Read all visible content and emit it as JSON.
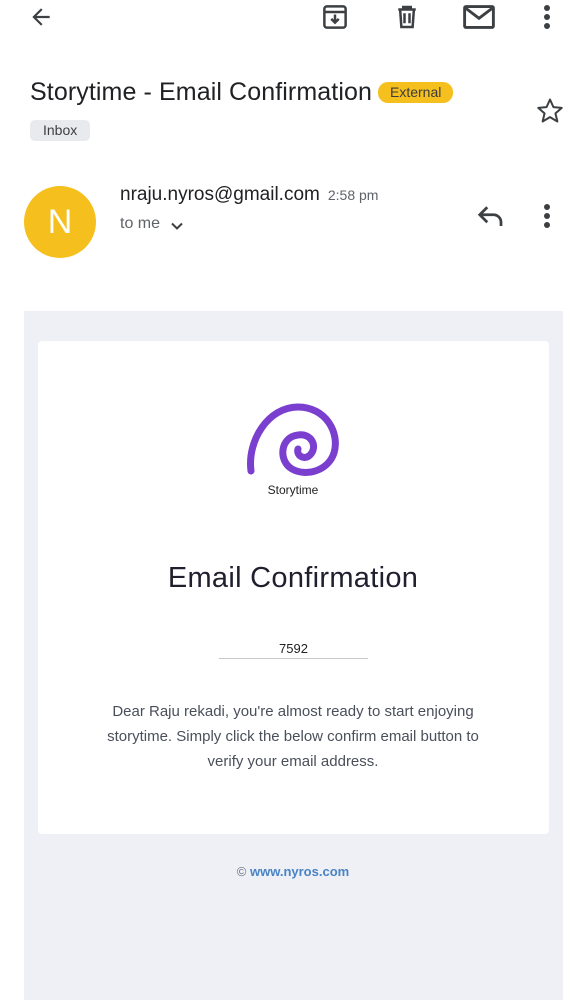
{
  "toolbar": {
    "back_icon": "arrow-left-icon",
    "archive_icon": "archive-icon",
    "delete_icon": "trash-icon",
    "mark_unread_icon": "mail-icon",
    "more_icon": "more-vert-icon"
  },
  "message": {
    "subject": "Storytime - Email Confirmation",
    "external_badge": "External",
    "label": "Inbox",
    "star_icon": "star-outline-icon",
    "sender_initial": "N",
    "sender_email": "nraju.nyros@gmail.com",
    "time": "2:58 pm",
    "recipient": "to me",
    "reply_icon": "reply-icon",
    "more_icon": "more-vert-icon"
  },
  "email_body": {
    "brand_name": "Storytime",
    "headline": "Email Confirmation",
    "code": "7592",
    "paragraph": "Dear Raju rekadi, you're almost ready to start enjoying storytime. Simply click the below confirm email button to verify your email address.",
    "footer_copyright": "© ",
    "footer_link": "www.nyros.com"
  },
  "colors": {
    "avatar_bg": "#f5bf1e",
    "badge_bg": "#f5bf1e",
    "logo_purple": "#7b3fd0",
    "email_bg": "#eef0f6",
    "link": "#4a83c4"
  }
}
